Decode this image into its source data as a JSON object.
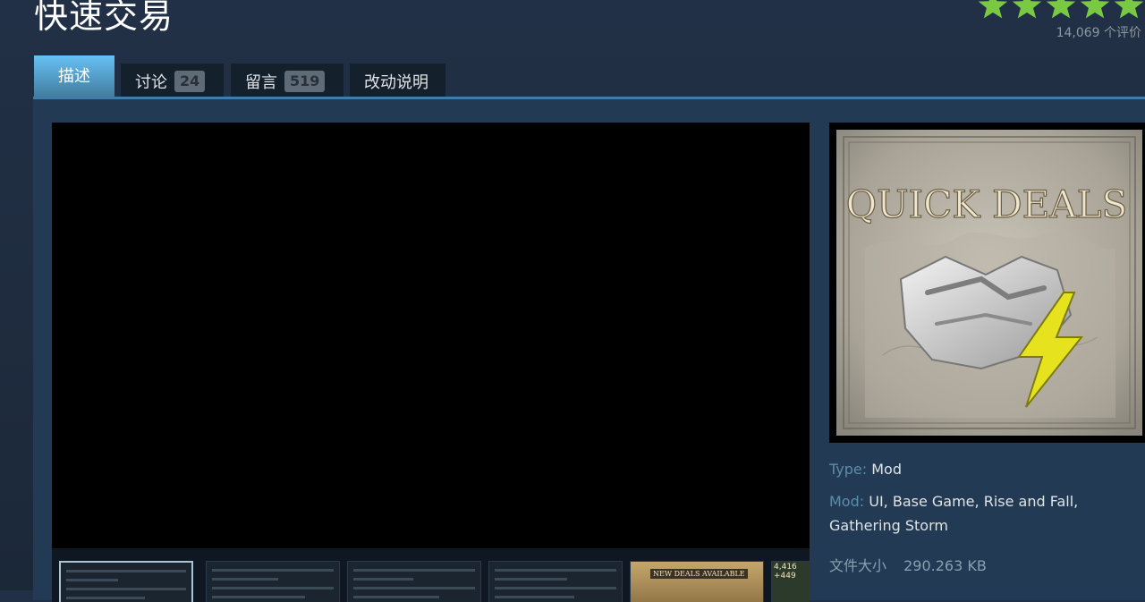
{
  "page": {
    "title": "快速交易",
    "rating": {
      "stars": 5,
      "count_text": "14,069 个评价"
    }
  },
  "tabs": [
    {
      "label": "描述",
      "active": true
    },
    {
      "label": "讨论",
      "count": "24"
    },
    {
      "label": "留言",
      "count": "519"
    },
    {
      "label": "改动说明"
    }
  ],
  "thumbnails": [
    {
      "caption": ""
    },
    {
      "caption": ""
    },
    {
      "caption": ""
    },
    {
      "caption": ""
    },
    {
      "caption": "NEW DEALS AVAILABLE"
    },
    {
      "caption": "4,416 +449"
    }
  ],
  "preview": {
    "heading": "QUICK DEALS"
  },
  "details": {
    "type_label": "Type:",
    "type_value": "Mod",
    "mod_label": "Mod:",
    "mod_tags": [
      "UI",
      "Base Game",
      "Rise and Fall",
      "Gathering Storm"
    ],
    "size_label": "文件大小",
    "size_value": "290.263 KB"
  },
  "colors": {
    "star": "#7ac943",
    "tab_active": "#67c1f5",
    "panel": "#223a53",
    "label_blue": "#5d8ca9"
  }
}
